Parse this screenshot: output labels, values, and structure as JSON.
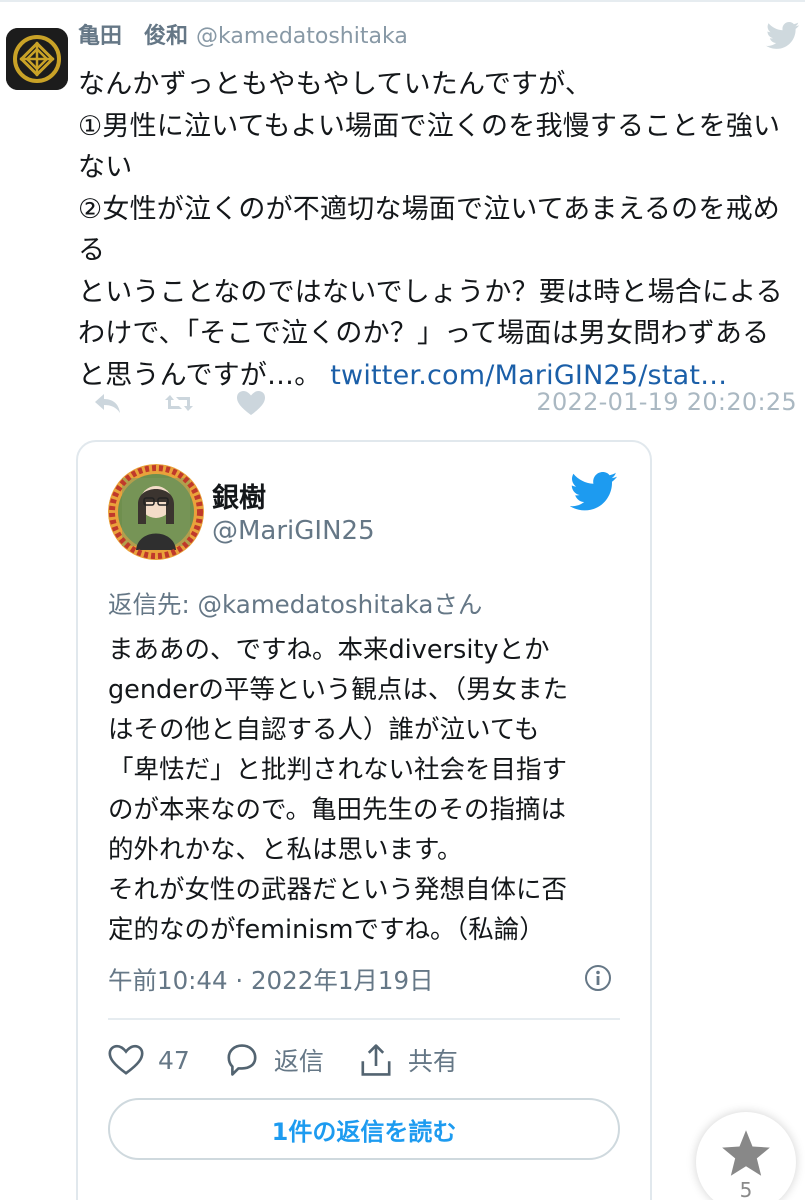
{
  "tweet": {
    "author_name": "亀田　俊和",
    "author_handle": "@kamedatoshitaka",
    "text_lines": [
      "なんかずっともやもやしていたんですが、",
      "①男性に泣いてもよい場面で泣くのを我慢することを強い",
      "ない",
      "②女性が泣くのが不適切な場面で泣いてあまえるのを戒め",
      "る",
      "ということなのではないでしょうか？要は時と場合による",
      "わけで、「そこで泣くのか？」って場面は男女問わずある"
    ],
    "last_line_text": "と思うんですが…。",
    "link_text": "twitter.com/MariGIN25/stat…",
    "timestamp": "2022-01-19 20:20:25",
    "icons": [
      "reply-icon",
      "retweet-icon",
      "like-icon",
      "twitter-bird-icon"
    ]
  },
  "quoted": {
    "name": "銀樹",
    "handle": "@MariGIN25",
    "reply_to": "返信先: @kamedatoshitakaさん",
    "text_lines": [
      "まああの、ですね。本来diversityとか",
      "genderの平等という観点は、（男女また",
      "はその他と自認する人）誰が泣いても",
      "「卑怯だ」と批判されない社会を目指す",
      "のが本来なので。亀田先生のその指摘は",
      "的外れかな、と私は思います。",
      "それが女性の武器だという発想自体に否",
      "定的なのがfeminismですね。（私論）"
    ],
    "meta": "午前10:44 · 2022年1月19日",
    "like_count": "47",
    "reply_label": "返信",
    "share_label": "共有",
    "read_replies_label": "1件の返信を読む",
    "colors": {
      "link": "#1d9bf0",
      "muted": "#657786"
    }
  },
  "favorite_fab": {
    "count": "5"
  }
}
